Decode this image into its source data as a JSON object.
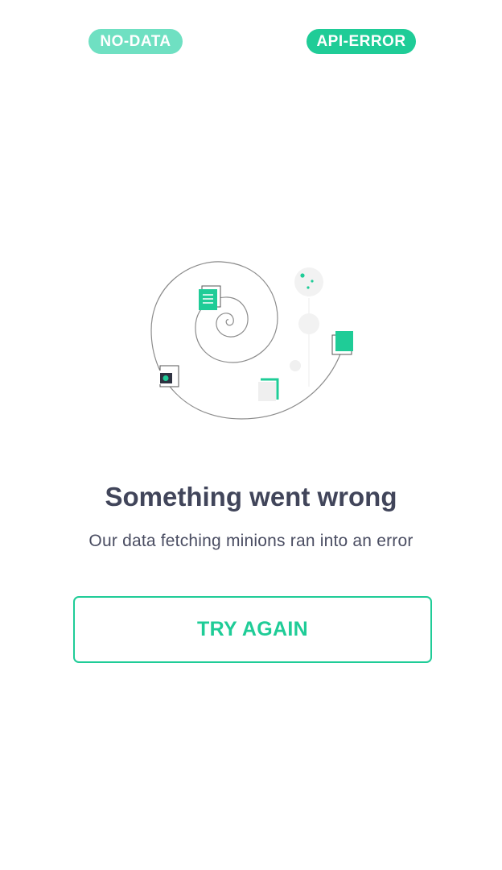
{
  "tabs": {
    "no_data_label": "NO-DATA",
    "api_error_label": "API-ERROR"
  },
  "error_state": {
    "title": "Something went wrong",
    "message": "Our data fetching minions ran into an error",
    "retry_label": "TRY AGAIN"
  },
  "colors": {
    "accent": "#1fcc97",
    "accent_light": "#6fe0c2",
    "title_text": "#41455a",
    "body_text": "#4a4d62"
  },
  "icons": [
    "spiral-illustration",
    "document-icon",
    "image-icon",
    "folder-corner-icon",
    "card-icon"
  ]
}
